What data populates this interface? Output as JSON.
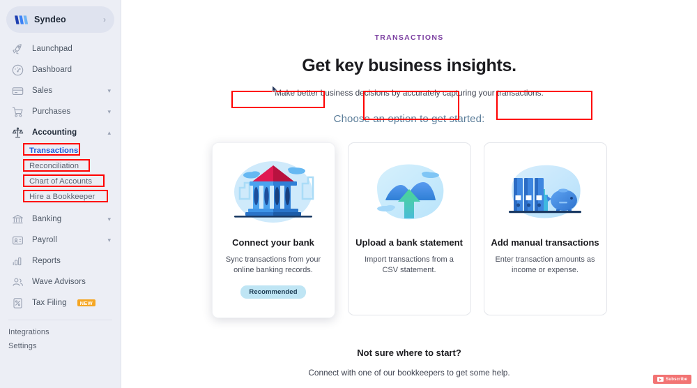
{
  "sidebar": {
    "brand": {
      "name": "Syndeo",
      "logo_icon": "syndeo-logo-icon",
      "chevron_icon": "chevron-right-icon"
    },
    "items": [
      {
        "label": "Launchpad",
        "icon": "rocket-icon",
        "expandable": false,
        "active": false
      },
      {
        "label": "Dashboard",
        "icon": "gauge-icon",
        "expandable": false,
        "active": false
      },
      {
        "label": "Sales",
        "icon": "card-icon",
        "expandable": true,
        "active": false
      },
      {
        "label": "Purchases",
        "icon": "cart-icon",
        "expandable": true,
        "active": false
      },
      {
        "label": "Accounting",
        "icon": "scale-icon",
        "expandable": true,
        "active": true
      }
    ],
    "sub_items": [
      {
        "label": "Transactions",
        "selected": true,
        "annotated": true
      },
      {
        "label": "Reconciliation",
        "selected": false,
        "annotated": true
      },
      {
        "label": "Chart of Accounts",
        "selected": false,
        "annotated": true
      },
      {
        "label": "Hire a Bookkeeper",
        "selected": false,
        "annotated": true
      }
    ],
    "items_after": [
      {
        "label": "Banking",
        "icon": "bank-icon",
        "expandable": true
      },
      {
        "label": "Payroll",
        "icon": "id-card-icon",
        "expandable": true
      },
      {
        "label": "Reports",
        "icon": "bar-chart-icon",
        "expandable": false
      },
      {
        "label": "Wave Advisors",
        "icon": "people-icon",
        "expandable": false
      },
      {
        "label": "Tax Filing",
        "icon": "percent-doc-icon",
        "expandable": false,
        "badge": "NEW"
      }
    ],
    "footer_links": [
      {
        "label": "Integrations"
      },
      {
        "label": "Settings"
      }
    ]
  },
  "main": {
    "eyebrow": "TRANSACTIONS",
    "heading": "Get key business insights.",
    "subheading": "Make better business decisions by accurately capturing your transactions.",
    "choose_prompt": "Choose an option to get started:",
    "cards": [
      {
        "title": "Connect your bank",
        "description": "Sync transactions from your online banking records.",
        "badge": "Recommended",
        "illustration": "bank-building-illustration",
        "annotated": true,
        "recommended": true
      },
      {
        "title": "Upload a bank statement",
        "description": "Import transactions from a CSV statement.",
        "badge": "",
        "illustration": "cloud-upload-arrow-illustration",
        "annotated": true,
        "recommended": false
      },
      {
        "title": "Add manual transactions",
        "description": "Enter transaction amounts as income or expense.",
        "badge": "",
        "illustration": "binders-piggybank-illustration",
        "annotated": true,
        "recommended": false
      }
    ],
    "footer": {
      "question": "Not sure where to start?",
      "detail": "Connect with one of our bookkeepers to get some help."
    }
  },
  "watermark": {
    "label": "Subscribe",
    "icon": "youtube-play-icon"
  },
  "colors": {
    "sidebar_bg": "#eceef5",
    "eyebrow_purple": "#7b3fa0",
    "selected_blue": "#1a56db",
    "annotation_red": "#ff0000",
    "recommended_badge": "#bfe5f4",
    "new_badge": "#f5a623",
    "choose_blue_gray": "#5b7d99"
  }
}
